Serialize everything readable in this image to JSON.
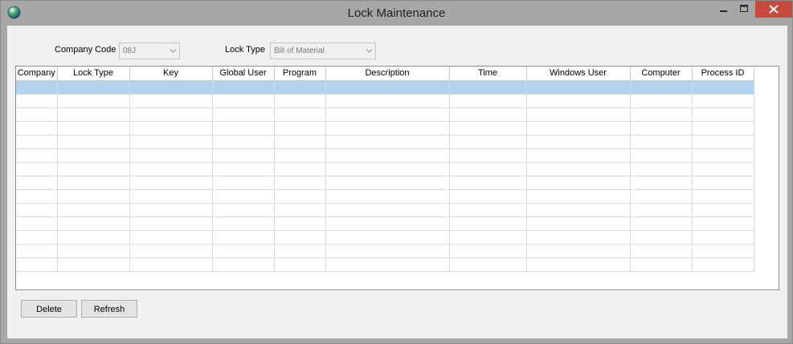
{
  "window": {
    "title": "Lock Maintenance",
    "close_color": "#c74a3e"
  },
  "filters": {
    "company_code_label": "Company Code",
    "company_code_value": "08J",
    "lock_type_label": "Lock Type",
    "lock_type_value": "Bill of Material"
  },
  "grid": {
    "columns": [
      "Company",
      "Lock Type",
      "Key",
      "Global User",
      "Program",
      "Description",
      "Time",
      "Windows User",
      "Computer",
      "Process ID"
    ],
    "selected_row_color": "#b3d4ee"
  },
  "buttons": {
    "delete_label": "Delete",
    "refresh_label": "Refresh"
  }
}
